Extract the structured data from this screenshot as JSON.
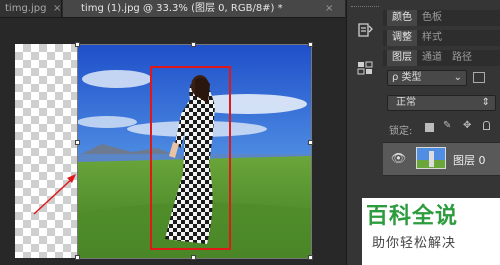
{
  "tabs": [
    {
      "label": "timg.jpg",
      "close": "×"
    },
    {
      "label": "timg (1).jpg @ 33.3% (图层 0, RGB/8#) *",
      "close": "×"
    }
  ],
  "panel_tabs_row1": [
    "颜色",
    "色板"
  ],
  "panel_tabs_row2": [
    "调整",
    "样式"
  ],
  "panel_tabs_row3": [
    "图层",
    "通道",
    "路径"
  ],
  "filter": {
    "label": "ρ 类型"
  },
  "blend_mode": "正常",
  "lock_label": "锁定:",
  "layer": {
    "name": "图层 0"
  },
  "watermark": {
    "title": "百科全说",
    "subtitle": "助你轻松解决"
  },
  "colors": {
    "accent_red": "#e01818",
    "panel_bg": "#353535",
    "selected_layer": "#595959"
  }
}
